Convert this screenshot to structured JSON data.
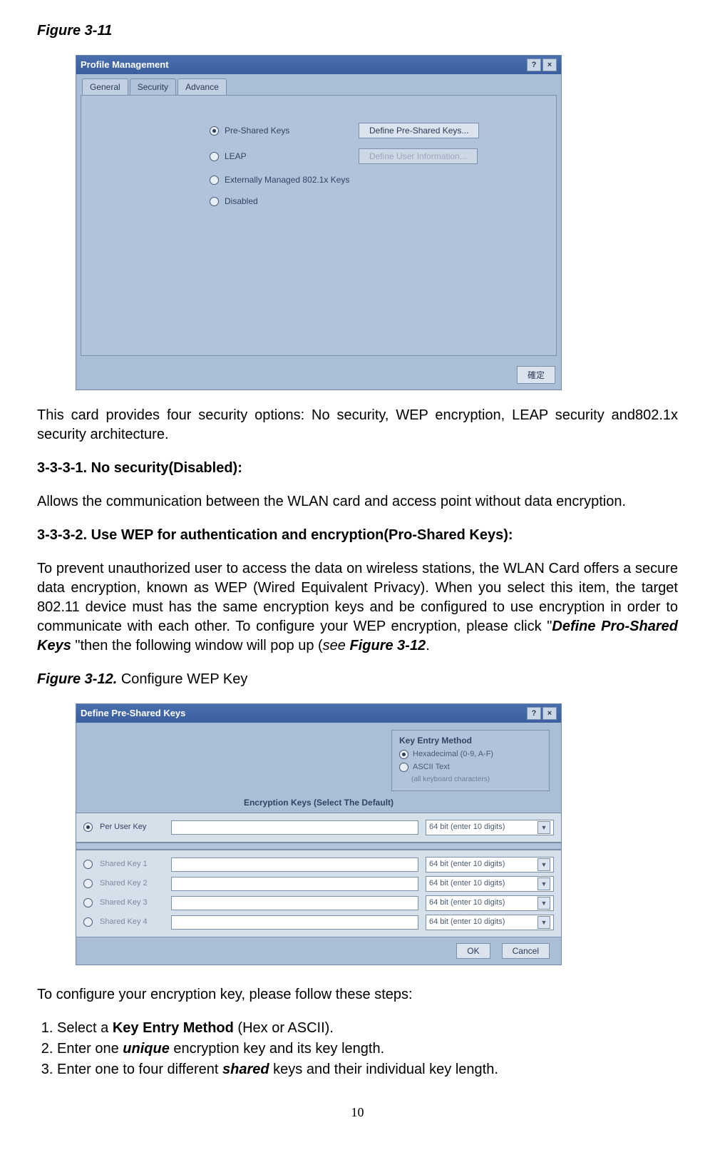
{
  "figure1": {
    "label": "Figure 3-11",
    "dialog": {
      "title": "Profile Management",
      "help": "?",
      "close": "×",
      "tabs": [
        "General",
        "Security",
        "Advance"
      ],
      "active_tab": 1,
      "options": [
        {
          "label": "Pre-Shared Keys",
          "selected": true,
          "button": "Define Pre-Shared Keys...",
          "button_disabled": false
        },
        {
          "label": "LEAP",
          "selected": false,
          "button": "Define User Information...",
          "button_disabled": true
        },
        {
          "label": "Externally Managed 802.1x Keys",
          "selected": false
        },
        {
          "label": "Disabled",
          "selected": false
        }
      ],
      "ok": "確定"
    }
  },
  "p1": "This card provides four security options: No security, WEP encryption, LEAP security and802.1x security architecture.",
  "h1": "3-3-3-1. No security(Disabled):",
  "p2": "Allows the communication between the WLAN card and access point without data encryption.",
  "h2": "3-3-3-2. Use WEP for authentication and encryption(Pro-Shared Keys):",
  "p3a": "To prevent unauthorized user to access the data on wireless stations, the WLAN Card offers a secure data encryption, known as WEP (Wired Equivalent Privacy). When you select this item, the target 802.11 device must has the same encryption keys and be configured to use encryption in order to communicate with each other. To configure your WEP encryption, please click \"",
  "p3b": "Define Pro-Shared Keys ",
  "p3c": "\"then the following window will pop up (",
  "p3d": "see ",
  "p3e": "Figure 3-12",
  "p3f": ".",
  "figure2": {
    "label": "Figure 3-12.",
    "caption": "   Configure WEP Key",
    "dialog": {
      "title": "Define Pre-Shared Keys",
      "help": "?",
      "close": "×",
      "method_title": "Key Entry Method",
      "methods": [
        {
          "label": "Hexadecimal (0-9, A-F)",
          "selected": true
        },
        {
          "label": "ASCII Text",
          "selected": false,
          "sub": "(all keyboard characters)"
        }
      ],
      "section_title": "Encryption Keys (Select The Default)",
      "rows": [
        {
          "label": "Per User Key",
          "selected": true,
          "enabled": true,
          "hint": "64 bit (enter 10 digits)"
        },
        {
          "label": "Shared Key 1",
          "selected": false,
          "enabled": false,
          "hint": "64 bit (enter 10 digits)"
        },
        {
          "label": "Shared Key 2",
          "selected": false,
          "enabled": false,
          "hint": "64 bit (enter 10 digits)"
        },
        {
          "label": "Shared Key 3",
          "selected": false,
          "enabled": false,
          "hint": "64 bit (enter 10 digits)"
        },
        {
          "label": "Shared Key 4",
          "selected": false,
          "enabled": false,
          "hint": "64 bit (enter 10 digits)"
        }
      ],
      "ok": "OK",
      "cancel": "Cancel"
    }
  },
  "p4": "To configure your encryption key, please follow these steps:",
  "steps": [
    {
      "a": "Select a ",
      "b": "Key Entry Method",
      "c": " (Hex or ASCII)."
    },
    {
      "a": "Enter one ",
      "b": "unique",
      "c": " encryption key and its key length."
    },
    {
      "a": "Enter one to four different ",
      "b": "shared",
      "c": " keys and their individual key length."
    }
  ],
  "page_number": "10"
}
